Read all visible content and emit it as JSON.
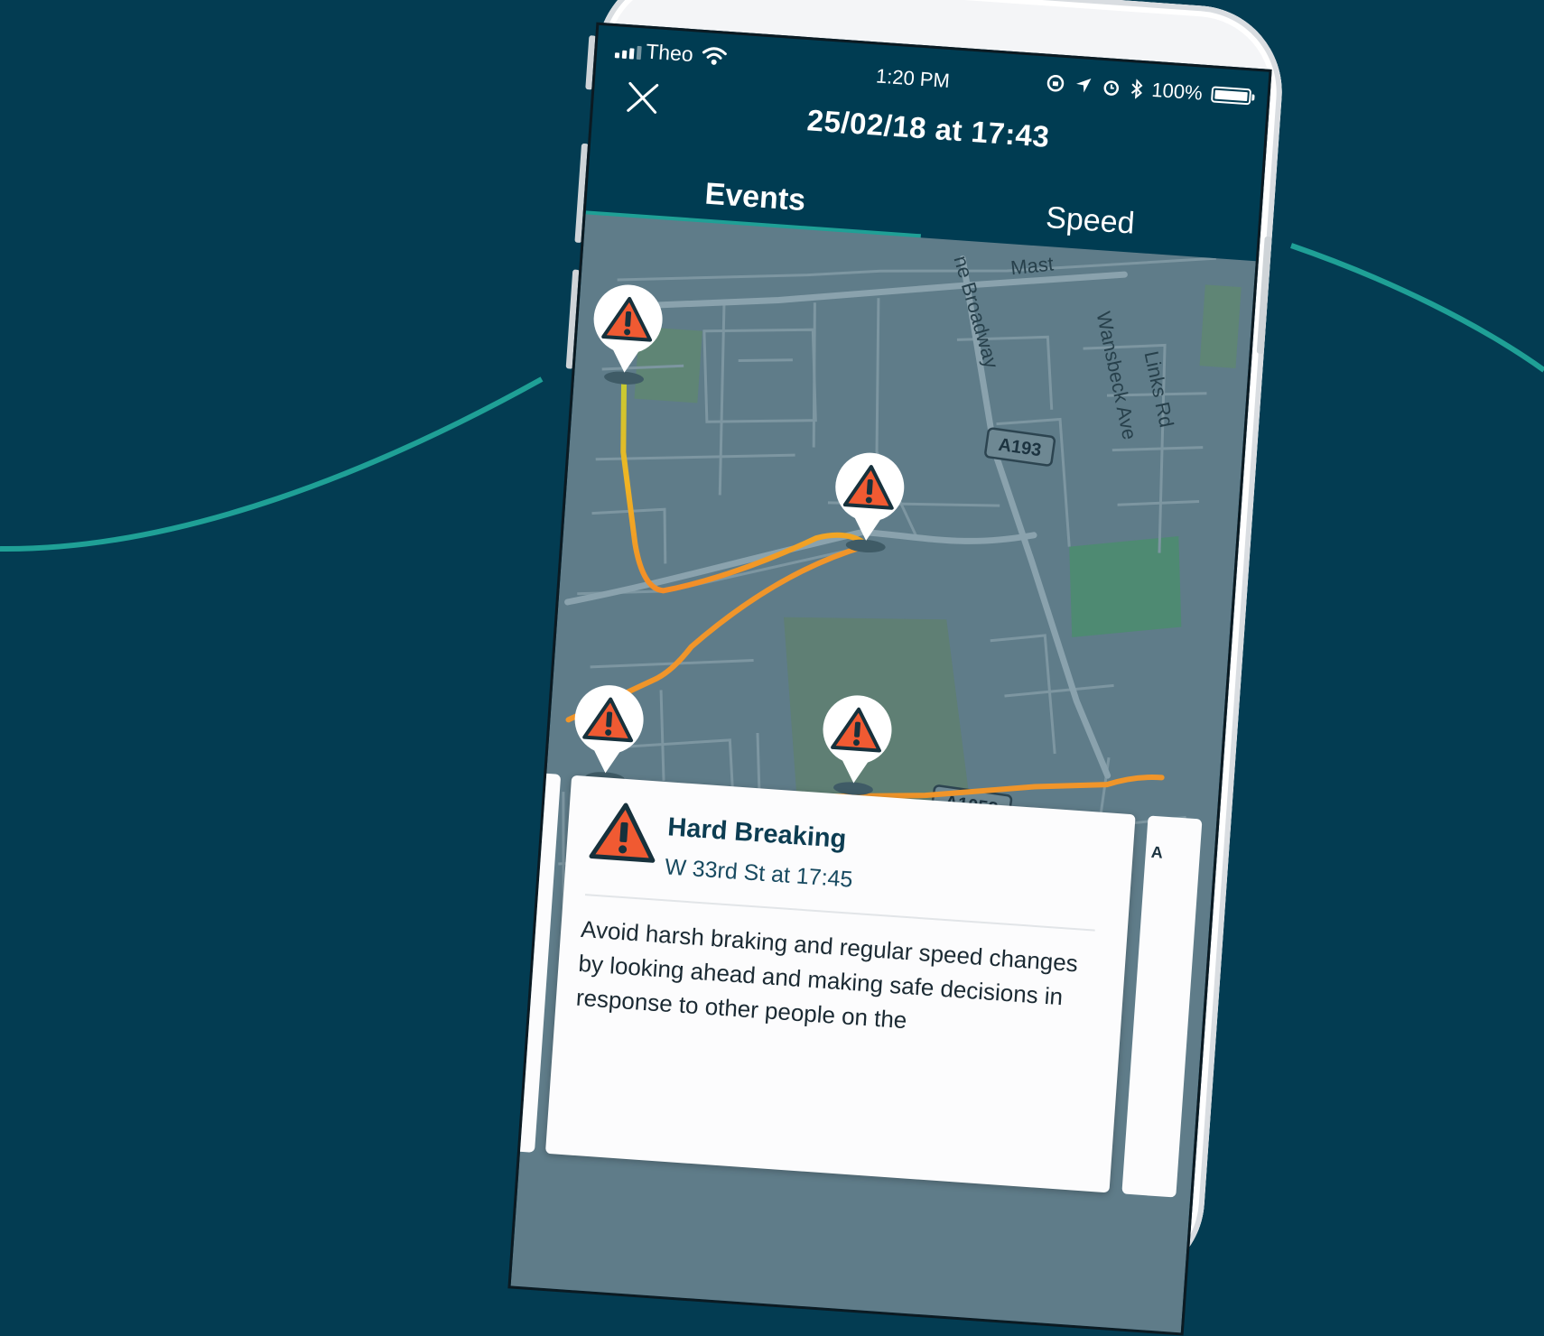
{
  "status_bar": {
    "carrier": "Theo",
    "time": "1:20 PM",
    "battery": "100%"
  },
  "nav": {
    "title": "25/02/18 at 17:43",
    "close_icon": "close-icon"
  },
  "tabs": [
    {
      "label": "Events",
      "active": true
    },
    {
      "label": "Speed",
      "active": false
    }
  ],
  "map": {
    "street_labels": [
      "Mast",
      "ne Broadway",
      "Wansbeck Ave",
      "Links Rd"
    ],
    "road_badges": [
      "A193",
      "A1058"
    ],
    "route_colors": {
      "start": "#c5cc33",
      "mid": "#f0b323",
      "end": "#f28c28"
    },
    "marker_icon": "warning-triangle-icon"
  },
  "event_card": {
    "title": "Hard Breaking",
    "subtitle": "W 33rd St at 17:45",
    "body": "Avoid harsh braking and regular speed changes by looking ahead and making safe decisions in response to other people on the"
  },
  "side_card_label": "A",
  "colors": {
    "background": "#033c52",
    "accent": "#1fa096",
    "warning": "#f05a32"
  }
}
